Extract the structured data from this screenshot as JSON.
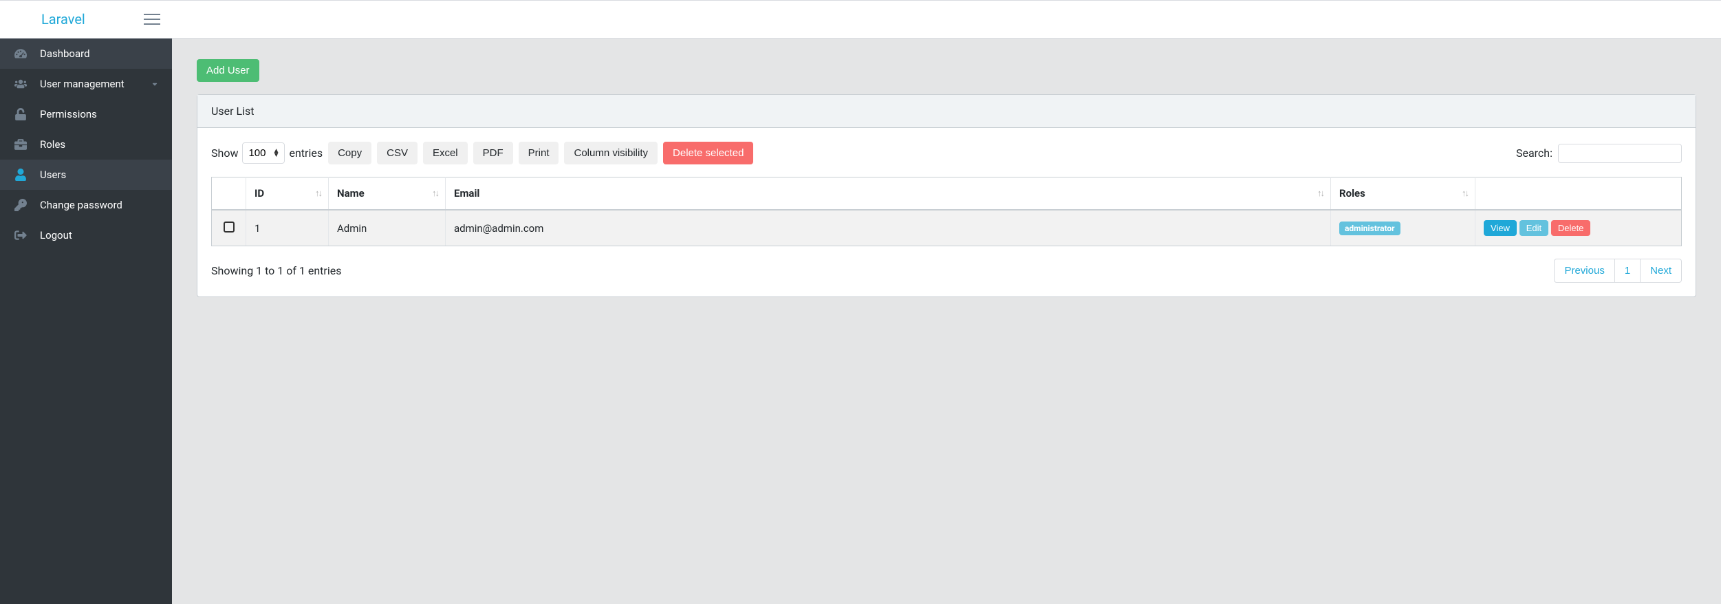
{
  "brand": "Laravel",
  "sidebar": {
    "items": [
      {
        "label": "Dashboard"
      },
      {
        "label": "User management"
      },
      {
        "label": "Permissions"
      },
      {
        "label": "Roles"
      },
      {
        "label": "Users"
      },
      {
        "label": "Change password"
      },
      {
        "label": "Logout"
      }
    ]
  },
  "buttons": {
    "add_user": "Add User",
    "copy": "Copy",
    "csv": "CSV",
    "excel": "Excel",
    "pdf": "PDF",
    "print": "Print",
    "colvis": "Column visibility",
    "delete_selected": "Delete selected",
    "view": "View",
    "edit": "Edit",
    "delete": "Delete"
  },
  "card": {
    "title": "User List"
  },
  "datatable": {
    "length_prefix": "Show",
    "length_value": "100",
    "length_suffix": "entries",
    "search_label": "Search:",
    "search_value": "",
    "columns": {
      "id": "ID",
      "name": "Name",
      "email": "Email",
      "roles": "Roles"
    },
    "rows": [
      {
        "id": "1",
        "name": "Admin",
        "email": "admin@admin.com",
        "role_badge": "administrator"
      }
    ],
    "info": "Showing 1 to 1 of 1 entries",
    "pagination": {
      "previous": "Previous",
      "page": "1",
      "next": "Next"
    }
  }
}
